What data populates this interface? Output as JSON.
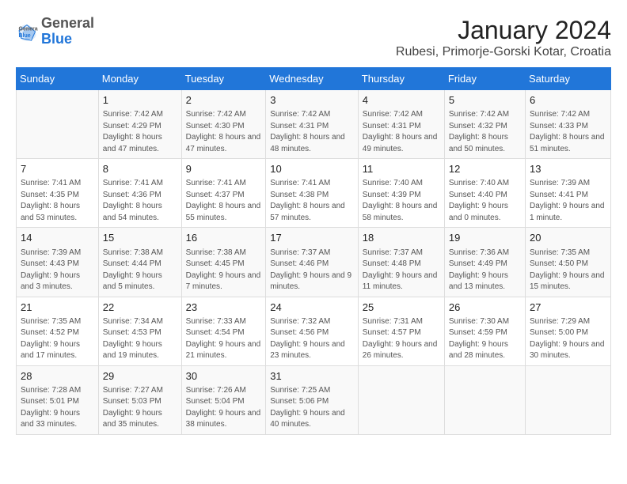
{
  "header": {
    "logo_line1": "General",
    "logo_line2": "Blue",
    "title": "January 2024",
    "subtitle": "Rubesi, Primorje-Gorski Kotar, Croatia"
  },
  "days_of_week": [
    "Sunday",
    "Monday",
    "Tuesday",
    "Wednesday",
    "Thursday",
    "Friday",
    "Saturday"
  ],
  "weeks": [
    [
      {
        "day": "",
        "sunrise": "",
        "sunset": "",
        "daylight": ""
      },
      {
        "day": "1",
        "sunrise": "Sunrise: 7:42 AM",
        "sunset": "Sunset: 4:29 PM",
        "daylight": "Daylight: 8 hours and 47 minutes."
      },
      {
        "day": "2",
        "sunrise": "Sunrise: 7:42 AM",
        "sunset": "Sunset: 4:30 PM",
        "daylight": "Daylight: 8 hours and 47 minutes."
      },
      {
        "day": "3",
        "sunrise": "Sunrise: 7:42 AM",
        "sunset": "Sunset: 4:31 PM",
        "daylight": "Daylight: 8 hours and 48 minutes."
      },
      {
        "day": "4",
        "sunrise": "Sunrise: 7:42 AM",
        "sunset": "Sunset: 4:31 PM",
        "daylight": "Daylight: 8 hours and 49 minutes."
      },
      {
        "day": "5",
        "sunrise": "Sunrise: 7:42 AM",
        "sunset": "Sunset: 4:32 PM",
        "daylight": "Daylight: 8 hours and 50 minutes."
      },
      {
        "day": "6",
        "sunrise": "Sunrise: 7:42 AM",
        "sunset": "Sunset: 4:33 PM",
        "daylight": "Daylight: 8 hours and 51 minutes."
      }
    ],
    [
      {
        "day": "7",
        "sunrise": "Sunrise: 7:41 AM",
        "sunset": "Sunset: 4:35 PM",
        "daylight": "Daylight: 8 hours and 53 minutes."
      },
      {
        "day": "8",
        "sunrise": "Sunrise: 7:41 AM",
        "sunset": "Sunset: 4:36 PM",
        "daylight": "Daylight: 8 hours and 54 minutes."
      },
      {
        "day": "9",
        "sunrise": "Sunrise: 7:41 AM",
        "sunset": "Sunset: 4:37 PM",
        "daylight": "Daylight: 8 hours and 55 minutes."
      },
      {
        "day": "10",
        "sunrise": "Sunrise: 7:41 AM",
        "sunset": "Sunset: 4:38 PM",
        "daylight": "Daylight: 8 hours and 57 minutes."
      },
      {
        "day": "11",
        "sunrise": "Sunrise: 7:40 AM",
        "sunset": "Sunset: 4:39 PM",
        "daylight": "Daylight: 8 hours and 58 minutes."
      },
      {
        "day": "12",
        "sunrise": "Sunrise: 7:40 AM",
        "sunset": "Sunset: 4:40 PM",
        "daylight": "Daylight: 9 hours and 0 minutes."
      },
      {
        "day": "13",
        "sunrise": "Sunrise: 7:39 AM",
        "sunset": "Sunset: 4:41 PM",
        "daylight": "Daylight: 9 hours and 1 minute."
      }
    ],
    [
      {
        "day": "14",
        "sunrise": "Sunrise: 7:39 AM",
        "sunset": "Sunset: 4:43 PM",
        "daylight": "Daylight: 9 hours and 3 minutes."
      },
      {
        "day": "15",
        "sunrise": "Sunrise: 7:38 AM",
        "sunset": "Sunset: 4:44 PM",
        "daylight": "Daylight: 9 hours and 5 minutes."
      },
      {
        "day": "16",
        "sunrise": "Sunrise: 7:38 AM",
        "sunset": "Sunset: 4:45 PM",
        "daylight": "Daylight: 9 hours and 7 minutes."
      },
      {
        "day": "17",
        "sunrise": "Sunrise: 7:37 AM",
        "sunset": "Sunset: 4:46 PM",
        "daylight": "Daylight: 9 hours and 9 minutes."
      },
      {
        "day": "18",
        "sunrise": "Sunrise: 7:37 AM",
        "sunset": "Sunset: 4:48 PM",
        "daylight": "Daylight: 9 hours and 11 minutes."
      },
      {
        "day": "19",
        "sunrise": "Sunrise: 7:36 AM",
        "sunset": "Sunset: 4:49 PM",
        "daylight": "Daylight: 9 hours and 13 minutes."
      },
      {
        "day": "20",
        "sunrise": "Sunrise: 7:35 AM",
        "sunset": "Sunset: 4:50 PM",
        "daylight": "Daylight: 9 hours and 15 minutes."
      }
    ],
    [
      {
        "day": "21",
        "sunrise": "Sunrise: 7:35 AM",
        "sunset": "Sunset: 4:52 PM",
        "daylight": "Daylight: 9 hours and 17 minutes."
      },
      {
        "day": "22",
        "sunrise": "Sunrise: 7:34 AM",
        "sunset": "Sunset: 4:53 PM",
        "daylight": "Daylight: 9 hours and 19 minutes."
      },
      {
        "day": "23",
        "sunrise": "Sunrise: 7:33 AM",
        "sunset": "Sunset: 4:54 PM",
        "daylight": "Daylight: 9 hours and 21 minutes."
      },
      {
        "day": "24",
        "sunrise": "Sunrise: 7:32 AM",
        "sunset": "Sunset: 4:56 PM",
        "daylight": "Daylight: 9 hours and 23 minutes."
      },
      {
        "day": "25",
        "sunrise": "Sunrise: 7:31 AM",
        "sunset": "Sunset: 4:57 PM",
        "daylight": "Daylight: 9 hours and 26 minutes."
      },
      {
        "day": "26",
        "sunrise": "Sunrise: 7:30 AM",
        "sunset": "Sunset: 4:59 PM",
        "daylight": "Daylight: 9 hours and 28 minutes."
      },
      {
        "day": "27",
        "sunrise": "Sunrise: 7:29 AM",
        "sunset": "Sunset: 5:00 PM",
        "daylight": "Daylight: 9 hours and 30 minutes."
      }
    ],
    [
      {
        "day": "28",
        "sunrise": "Sunrise: 7:28 AM",
        "sunset": "Sunset: 5:01 PM",
        "daylight": "Daylight: 9 hours and 33 minutes."
      },
      {
        "day": "29",
        "sunrise": "Sunrise: 7:27 AM",
        "sunset": "Sunset: 5:03 PM",
        "daylight": "Daylight: 9 hours and 35 minutes."
      },
      {
        "day": "30",
        "sunrise": "Sunrise: 7:26 AM",
        "sunset": "Sunset: 5:04 PM",
        "daylight": "Daylight: 9 hours and 38 minutes."
      },
      {
        "day": "31",
        "sunrise": "Sunrise: 7:25 AM",
        "sunset": "Sunset: 5:06 PM",
        "daylight": "Daylight: 9 hours and 40 minutes."
      },
      {
        "day": "",
        "sunrise": "",
        "sunset": "",
        "daylight": ""
      },
      {
        "day": "",
        "sunrise": "",
        "sunset": "",
        "daylight": ""
      },
      {
        "day": "",
        "sunrise": "",
        "sunset": "",
        "daylight": ""
      }
    ]
  ]
}
